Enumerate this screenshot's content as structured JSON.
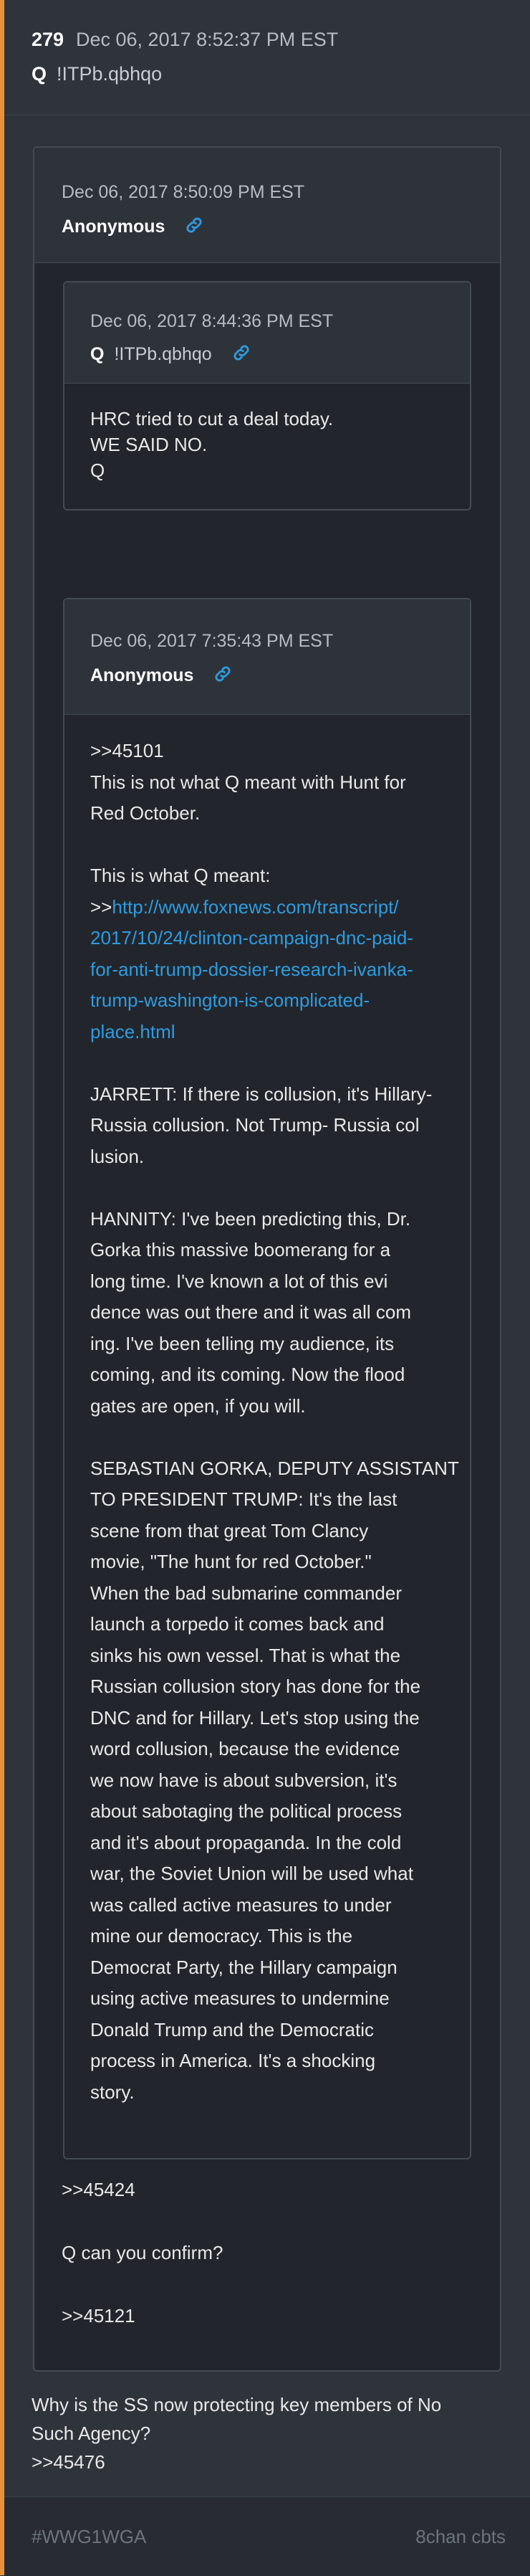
{
  "post": {
    "number": "279",
    "date": "Dec 06, 2017 8:52:37 PM EST",
    "author": "Q",
    "trip": "!ITPb.qbhqo"
  },
  "quoted": {
    "date": "Dec 06, 2017 8:50:09 PM EST",
    "author": "Anonymous",
    "inner1": {
      "date": "Dec 06, 2017 8:44:36 PM EST",
      "author": "Q",
      "trip": "!ITPb.qbhqo",
      "lines": [
        "HRC tried to cut a deal today.",
        "WE SAID NO.",
        "Q"
      ]
    },
    "inner2": {
      "date": "Dec 06, 2017 7:35:43 PM EST",
      "author": "Anonymous",
      "lines_a": [
        ">>45101",
        "This is not what Q meant with Hunt for",
        "Red October.",
        "",
        "This is what Q meant:"
      ],
      "link_prefix": ">>",
      "link_lines": [
        "http://www.foxnews.com/transcript/",
        "2017/10/24/clinton-campaign-dnc-paid-",
        "for-anti-trump-dossier-research-ivanka-",
        "trump-washington-is-complicated-",
        "place.html"
      ],
      "lines_b": [
        "",
        "JARRETT: If there is collusion, it's Hillary-",
        "Russia collusion. Not Trump- Russia col",
        "lusion.",
        "",
        "HANNITY: I've been predicting this, Dr.",
        "Gorka this massive boomerang for a",
        "long time. I've known a lot of this evi",
        "dence was out there and it was all com",
        "ing. I've been telling my audience, its",
        "coming, and its coming. Now the flood",
        "gates are open, if you will.",
        "",
        "SEBASTIAN GORKA, DEPUTY ASSISTANT",
        "TO PRESIDENT TRUMP: It's the last",
        "scene from that great Tom Clancy",
        "movie, \"The hunt for red October.\"",
        "When the bad submarine commander",
        "launch a torpedo it comes back and",
        "sinks his own vessel. That is what the",
        "Russian collusion story has done for the",
        "DNC and for Hillary. Let's stop using the",
        "word collusion, because the evidence",
        "we now have is about subversion, it's",
        "about sabotaging the political process",
        "and it's about propaganda. In the cold",
        "war, the Soviet Union will be used what",
        "was called active measures to under",
        "mine our democracy. This is the",
        "Democrat Party, the Hillary campaign",
        "using active measures to undermine",
        "Donald Trump and the Democratic",
        "process in America. It's a shocking",
        "story."
      ]
    },
    "after_lines": [
      ">>45424",
      "",
      "Q can you confirm?",
      "",
      ">>45121"
    ]
  },
  "reply_lines": [
    "Why is the SS now protecting key members of No",
    "Such Agency?",
    ">>45476"
  ],
  "footer": {
    "hashtag": "#WWG1WGA",
    "source": "8chan cbts"
  },
  "colors": {
    "accent": "#e8913a",
    "link": "#2e9be0",
    "background": "#2f343b"
  },
  "icons": [
    "link-icon"
  ]
}
